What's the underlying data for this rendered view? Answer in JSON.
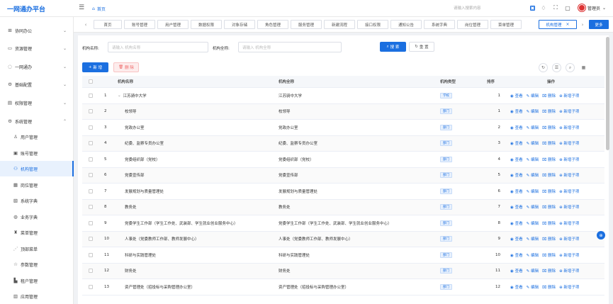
{
  "app": {
    "title": "一网通办平台"
  },
  "header": {
    "home_label": "首页",
    "search_placeholder": "请输入搜索内容",
    "user_name": "管理员",
    "icons": [
      "menu-toggle-icon",
      "home-icon",
      "apps-icon",
      "shirt-icon",
      "fullscreen-icon",
      "screen-icon",
      "chevron-down-icon"
    ]
  },
  "sidebar": {
    "groups": [
      {
        "label": "协同办公",
        "icon": "grid-icon"
      },
      {
        "label": "资源管理",
        "icon": "folder-icon"
      },
      {
        "label": "一网通办",
        "icon": "ring-icon"
      },
      {
        "label": "基础配置",
        "icon": "config-icon"
      },
      {
        "label": "权限管理",
        "icon": "lock-icon"
      },
      {
        "label": "系统管理",
        "icon": "settings-icon"
      }
    ],
    "sub_items": [
      {
        "label": "用户管理",
        "icon": "user-icon"
      },
      {
        "label": "账号管理",
        "icon": "id-card-icon"
      },
      {
        "label": "机构管理",
        "icon": "org-icon",
        "active": true
      },
      {
        "label": "岗位管理",
        "icon": "post-icon"
      },
      {
        "label": "系统字典",
        "icon": "dict-icon"
      },
      {
        "label": "业务字典",
        "icon": "business-dict-icon"
      },
      {
        "label": "菜单管理",
        "icon": "menu-tree-icon"
      },
      {
        "label": "顶部菜单",
        "icon": "top-menu-icon"
      },
      {
        "label": "参数管理",
        "icon": "star-icon"
      },
      {
        "label": "租户管理",
        "icon": "tenant-icon"
      },
      {
        "label": "应用管理",
        "icon": "app-icon"
      }
    ]
  },
  "tabs": {
    "items": [
      "首页",
      "账号管理",
      "用户管理",
      "数据权限",
      "对象存储",
      "角色管理",
      "服务管理",
      "新建流程",
      "接口权限",
      "通知公告",
      "系统字典",
      "岗位管理",
      "菜单管理",
      "机构管理"
    ],
    "active_index": 13,
    "more_label": "更多"
  },
  "search_form": {
    "name_label": "机构名称:",
    "name_placeholder": "请输入 机构名称",
    "fullname_label": "机构全称:",
    "fullname_placeholder": "请输入 机构全称",
    "search_button": "搜 索",
    "reset_button": "重 置"
  },
  "toolbar": {
    "add_button": "新 增",
    "delete_button": "删 除"
  },
  "table": {
    "columns": [
      "机构名称",
      "机构全称",
      "机构类型",
      "排序",
      "操作"
    ],
    "type_tag_root": "学校",
    "type_tag": "部门",
    "op_labels": {
      "view": "查看",
      "edit": "编辑",
      "delete": "删除",
      "add_child": "新增子项"
    },
    "rows": [
      {
        "index": "1",
        "name": "江苏骑中大学",
        "fullname": "江苏骑中大学",
        "type": "学校",
        "sort": "1",
        "expand": true
      },
      {
        "index": "2",
        "name": "校领导",
        "fullname": "校领导",
        "type": "部门",
        "sort": "1"
      },
      {
        "index": "3",
        "name": "党政办公室",
        "fullname": "党政办公室",
        "type": "部门",
        "sort": "2"
      },
      {
        "index": "4",
        "name": "纪委、监察专员办公室",
        "fullname": "纪委、监察专员办公室",
        "type": "部门",
        "sort": "3"
      },
      {
        "index": "5",
        "name": "党委组织部（党校）",
        "fullname": "党委组织部（党校）",
        "type": "部门",
        "sort": "4"
      },
      {
        "index": "6",
        "name": "党委宣传部",
        "fullname": "党委宣传部",
        "type": "部门",
        "sort": "5"
      },
      {
        "index": "7",
        "name": "发展规划与质量管理处",
        "fullname": "发展规划与质量管理处",
        "type": "部门",
        "sort": "6"
      },
      {
        "index": "8",
        "name": "教务处",
        "fullname": "教务处",
        "type": "部门",
        "sort": "7"
      },
      {
        "index": "9",
        "name": "党委学生工作部（学生工作处、武装部、学生就业创业服务中心）",
        "fullname": "党委学生工作部（学生工作处、武装部、学生就业创业服务中心）",
        "type": "部门",
        "sort": "8"
      },
      {
        "index": "10",
        "name": "人事处（党委教师工作部、教师发展中心）",
        "fullname": "人事处（党委教师工作部、教师发展中心）",
        "type": "部门",
        "sort": "9"
      },
      {
        "index": "11",
        "name": "科研与实践管理处",
        "fullname": "科研与实践管理处",
        "type": "部门",
        "sort": "10"
      },
      {
        "index": "12",
        "name": "财务处",
        "fullname": "财务处",
        "type": "部门",
        "sort": "11"
      },
      {
        "index": "13",
        "name": "资产管理处（招投标与采购管理办公室）",
        "fullname": "资产管理处（招投标与采购管理办公室）",
        "type": "部门",
        "sort": "12"
      }
    ]
  },
  "colors": {
    "primary": "#1b6fe0",
    "active_bg": "#e8f1fd",
    "danger": "#e66666"
  }
}
